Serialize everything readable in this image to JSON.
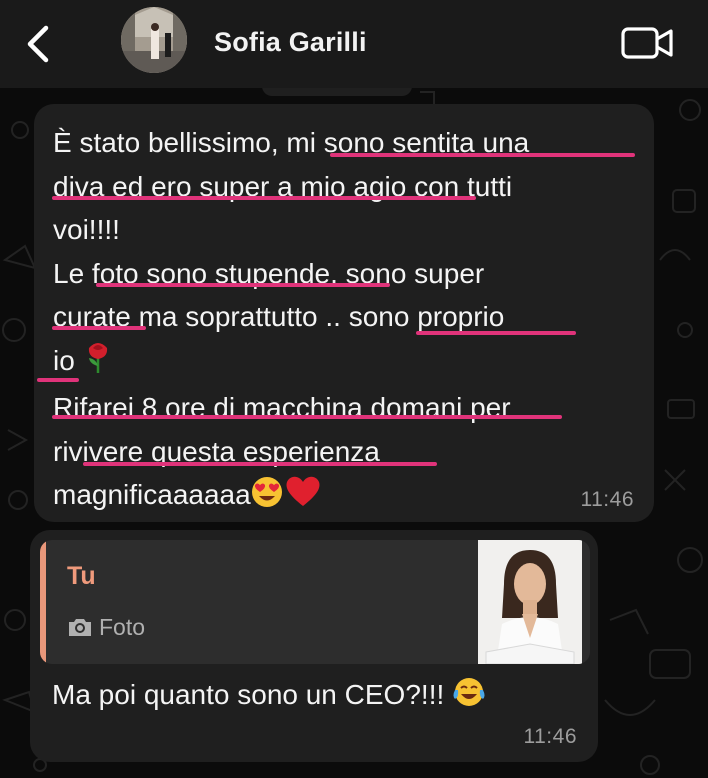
{
  "header": {
    "contact_name": "Sofia Garilli"
  },
  "messages": [
    {
      "direction": "incoming",
      "lines": [
        "È stato bellissimo, mi sono sentita una",
        "diva ed ero super a mio agio con tutti",
        "voi!!!!",
        "Le foto sono stupende, sono super",
        "curate ma soprattutto .. sono proprio",
        "io",
        "Rifarei 8 ore di macchina domani per",
        "rivivere questa esperienza",
        "magnificaaaaaa"
      ],
      "emojis": {
        "line6": "rose-emoji",
        "line9": [
          "heart-eyes-emoji",
          "red-heart-emoji"
        ]
      },
      "time": "11:46"
    },
    {
      "direction": "incoming",
      "reply_to": {
        "author": "Tu",
        "kind": "Foto",
        "icon": "camera-icon"
      },
      "text": "Ma poi quanto sono un CEO?!!!",
      "emoji": "tears-of-joy-emoji",
      "time": "11:46"
    }
  ],
  "colors": {
    "background": "#0b0b0b",
    "header": "#1a1a1a",
    "bubble": "#1f1f1f",
    "quote": "#2d2d2d",
    "quote_accent": "#e8977a",
    "underline": "#e0337a",
    "timestamp": "#9d9d9d"
  }
}
